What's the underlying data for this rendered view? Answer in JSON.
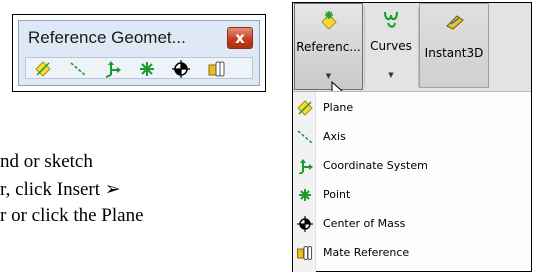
{
  "toolbar": {
    "title": "Reference Geomet...",
    "close_label": "x",
    "icons": [
      "plane-icon",
      "axis-icon",
      "coordinate-system-icon",
      "point-icon",
      "center-of-mass-icon",
      "mate-reference-icon"
    ]
  },
  "body_text": {
    "line1": "nd or sketch",
    "line2": "r, click Insert ➢",
    "line3": "r or click the Plane"
  },
  "ribbon": {
    "buttons": [
      {
        "label": "Referenc...",
        "icon": "reference-geometry-icon",
        "has_dropdown": true
      },
      {
        "label": "Curves",
        "icon": "curves-icon",
        "has_dropdown": true
      },
      {
        "label": "Instant3D",
        "icon": "instant3d-icon",
        "has_dropdown": false
      }
    ]
  },
  "menu": {
    "items": [
      {
        "label": "Plane",
        "icon": "plane-icon"
      },
      {
        "label": "Axis",
        "icon": "axis-icon"
      },
      {
        "label": "Coordinate System",
        "icon": "coordinate-system-icon"
      },
      {
        "label": "Point",
        "icon": "point-icon"
      },
      {
        "label": "Center of Mass",
        "icon": "center-of-mass-icon"
      },
      {
        "label": "Mate Reference",
        "icon": "mate-reference-icon"
      }
    ]
  },
  "colors": {
    "close_button": "#c43d21",
    "toolbar_bg": "#dfe9f5",
    "icon_green": "#1c9a2a",
    "icon_yellow": "#e8c21c"
  }
}
